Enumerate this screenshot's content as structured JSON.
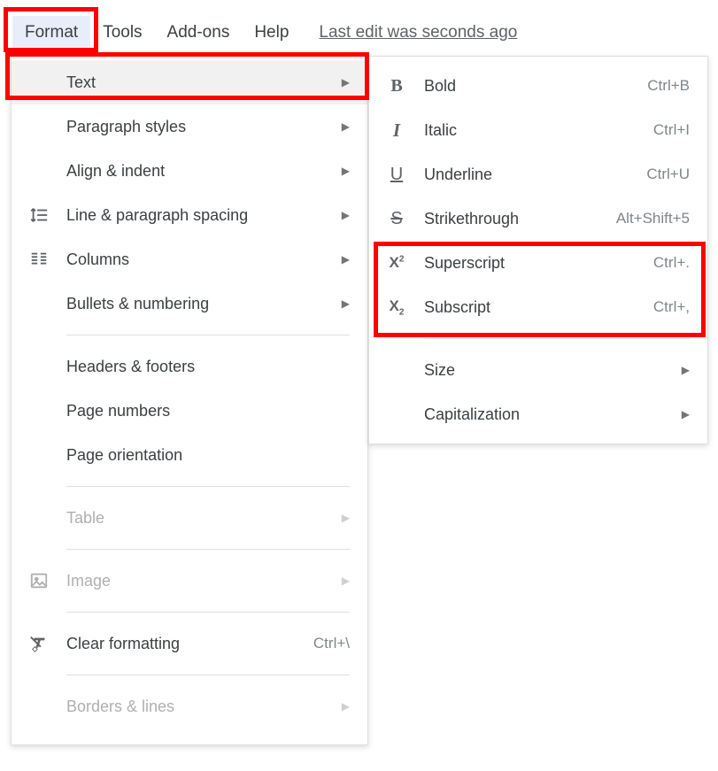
{
  "menubar": {
    "format": "Format",
    "tools": "Tools",
    "addons": "Add-ons",
    "help": "Help",
    "last_edit": "Last edit was seconds ago"
  },
  "format_menu": {
    "text": "Text",
    "paragraph_styles": "Paragraph styles",
    "align_indent": "Align & indent",
    "line_spacing": "Line & paragraph spacing",
    "columns": "Columns",
    "bullets_numbering": "Bullets & numbering",
    "headers_footers": "Headers & footers",
    "page_numbers": "Page numbers",
    "page_orientation": "Page orientation",
    "table": "Table",
    "image": "Image",
    "clear_formatting": "Clear formatting",
    "clear_formatting_shortcut": "Ctrl+\\",
    "borders_lines": "Borders & lines"
  },
  "text_menu": {
    "bold": "Bold",
    "bold_shortcut": "Ctrl+B",
    "italic": "Italic",
    "italic_shortcut": "Ctrl+I",
    "underline": "Underline",
    "underline_shortcut": "Ctrl+U",
    "strikethrough": "Strikethrough",
    "strikethrough_shortcut": "Alt+Shift+5",
    "superscript": "Superscript",
    "superscript_shortcut": "Ctrl+.",
    "subscript": "Subscript",
    "subscript_shortcut": "Ctrl+,",
    "size": "Size",
    "capitalization": "Capitalization"
  }
}
